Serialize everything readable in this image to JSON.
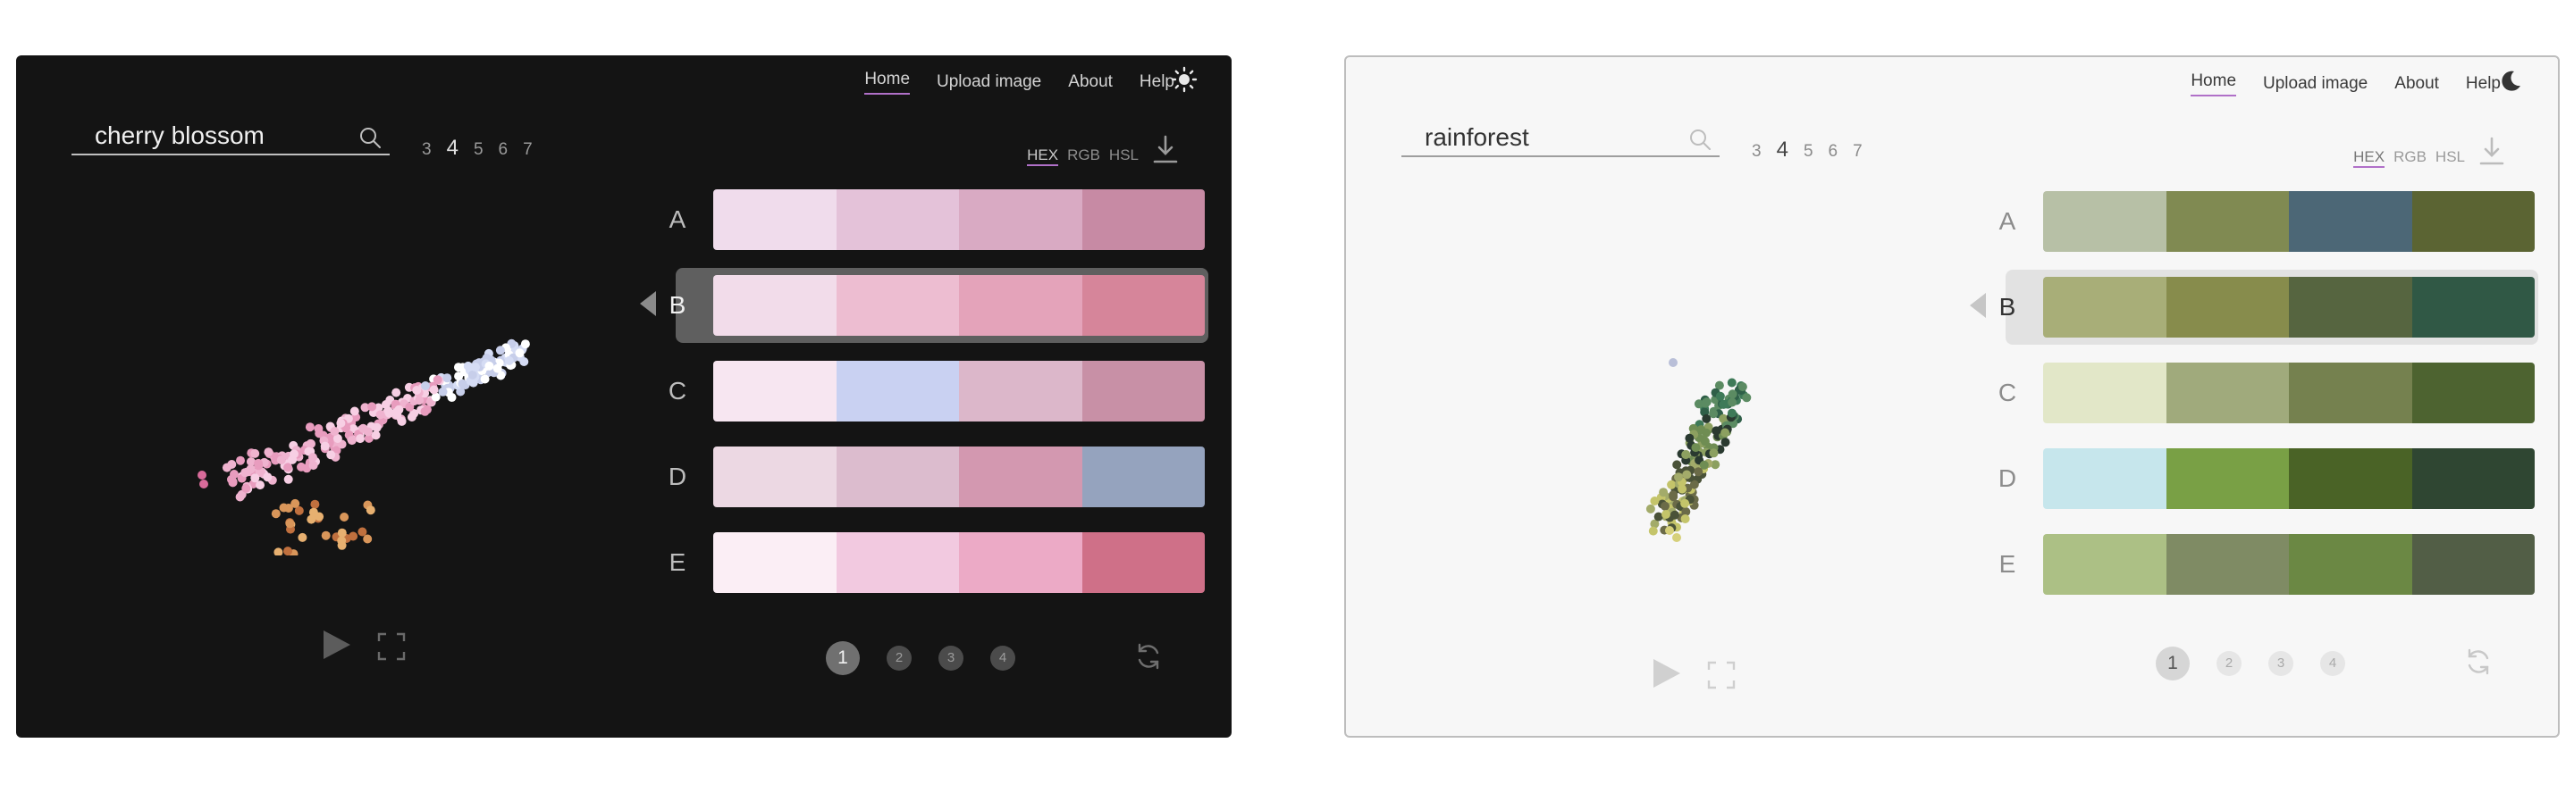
{
  "panels": [
    {
      "theme": "dark",
      "nav": [
        "Home",
        "Upload image",
        "About",
        "Help"
      ],
      "active_nav": "Home",
      "theme_icon": "sun-icon",
      "search": {
        "value": "cherry blossom",
        "icon": "search-icon"
      },
      "counts": [
        "3",
        "4",
        "5",
        "6",
        "7"
      ],
      "selected_count": "4",
      "formats": [
        "HEX",
        "RGB",
        "HSL"
      ],
      "selected_format": "HEX",
      "download_icon": "download-icon",
      "palettes": [
        {
          "label": "A",
          "colors": [
            "#f0dcec",
            "#e4c2d9",
            "#d9aac3",
            "#c78aa4"
          ]
        },
        {
          "label": "B",
          "colors": [
            "#f2dcea",
            "#edbdd1",
            "#e4a3ba",
            "#d6859a"
          ]
        },
        {
          "label": "C",
          "colors": [
            "#f7e6f1",
            "#c9d1f2",
            "#dcb7ca",
            "#c890a6"
          ]
        },
        {
          "label": "D",
          "colors": [
            "#ecd8e3",
            "#dcbcce",
            "#d398b0",
            "#95a3be"
          ]
        },
        {
          "label": "E",
          "colors": [
            "#fbeef5",
            "#f2c9e0",
            "#ecaac6",
            "#cf7088"
          ]
        }
      ],
      "selected_palette": "B",
      "pages": [
        "1",
        "2",
        "3",
        "4"
      ],
      "current_page": "1",
      "scatter_colors": [
        "#f7cfe4",
        "#efb3cf",
        "#e89cbe",
        "#d5dcf4",
        "#ffffff",
        "#c7ceea",
        "#e07aa6",
        "#f2c4d8",
        "#d9965a",
        "#c0703e",
        "#e7b070",
        "#d86b9a"
      ]
    },
    {
      "theme": "light",
      "nav": [
        "Home",
        "Upload image",
        "About",
        "Help"
      ],
      "active_nav": "Home",
      "theme_icon": "moon-icon",
      "search": {
        "value": "rainforest",
        "icon": "search-icon"
      },
      "counts": [
        "3",
        "4",
        "5",
        "6",
        "7"
      ],
      "selected_count": "4",
      "formats": [
        "HEX",
        "RGB",
        "HSL"
      ],
      "selected_format": "HEX",
      "download_icon": "download-icon",
      "palettes": [
        {
          "label": "A",
          "colors": [
            "#b7c0a6",
            "#808a52",
            "#4c6776",
            "#5b6433"
          ]
        },
        {
          "label": "B",
          "colors": [
            "#a8ae78",
            "#878c4c",
            "#566540",
            "#305845"
          ]
        },
        {
          "label": "C",
          "colors": [
            "#e2e7c8",
            "#a0aa7c",
            "#75814f",
            "#4d6330"
          ]
        },
        {
          "label": "D",
          "colors": [
            "#c6e6ec",
            "#79a045",
            "#4a6326",
            "#2f4632"
          ]
        },
        {
          "label": "E",
          "colors": [
            "#acc085",
            "#7f8b64",
            "#6b8844",
            "#525e46"
          ]
        }
      ],
      "selected_palette": "B",
      "pages": [
        "1",
        "2",
        "3",
        "4"
      ],
      "current_page": "1",
      "scatter_colors": [
        "#2f5f48",
        "#3e7a58",
        "#5b8b62",
        "#2a3a30",
        "#6f8d53",
        "#8ca060",
        "#a3ab6a",
        "#c4c46a",
        "#6b6b48",
        "#4a5238",
        "#b9bfd8",
        "#d6d07a"
      ]
    }
  ]
}
